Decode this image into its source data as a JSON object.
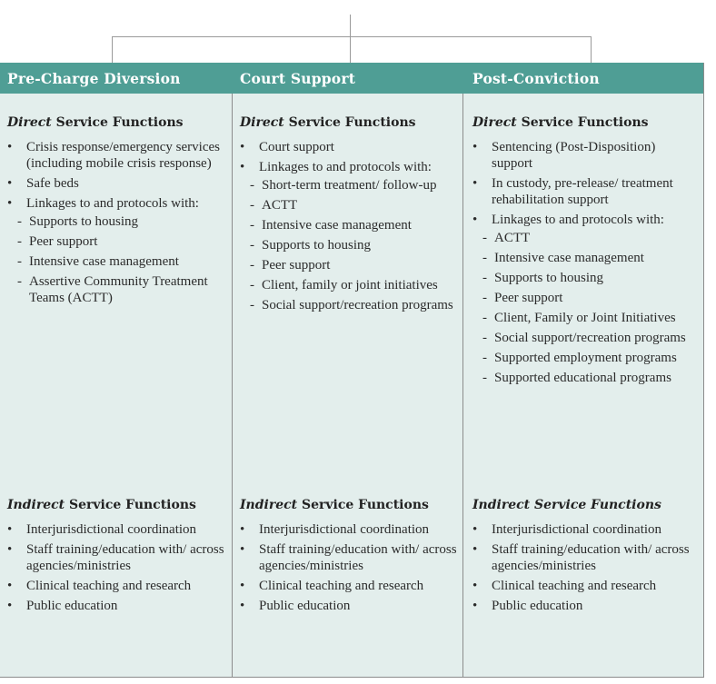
{
  "columns": [
    {
      "title": "Pre-Charge Diversion",
      "direct": {
        "title_em": "Direct",
        "title_rest": " Service Functions",
        "items": [
          {
            "text": "Crisis response/emergency services (including mobile crisis response)"
          },
          {
            "text": "Safe beds"
          },
          {
            "text": "Linkages to and protocols with:",
            "sub": [
              "Supports to housing",
              "Peer support",
              "Intensive case management",
              "Assertive Community Treatment Teams (ACTT)"
            ]
          }
        ]
      },
      "indirect": {
        "title_em": "Indirect",
        "title_rest": " Service Functions",
        "items": [
          "Interjurisdictional coordination",
          "Staff training/education with/ across agencies/ministries",
          "Clinical teaching and research",
          "Public education"
        ]
      }
    },
    {
      "title": "Court Support",
      "direct": {
        "title_em": "Direct",
        "title_rest": " Service Functions",
        "items": [
          {
            "text": "Court support"
          },
          {
            "text": "Linkages to and protocols with:",
            "sub": [
              "Short-term treatment/ follow-up",
              "ACTT",
              "Intensive case management",
              "Supports to housing",
              "Peer support",
              "Client, family or joint initiatives",
              "Social support/recreation programs"
            ]
          }
        ]
      },
      "indirect": {
        "title_em": "Indirect",
        "title_rest": " Service Functions",
        "items": [
          "Interjurisdictional coordination",
          "Staff training/education with/ across agencies/ministries",
          "Clinical teaching and research",
          "Public education"
        ]
      }
    },
    {
      "title": "Post-Conviction",
      "direct": {
        "title_em": "Direct",
        "title_rest": " Service Functions",
        "items": [
          {
            "text": "Sentencing (Post-Disposition) support"
          },
          {
            "text": "In custody, pre-release/ treatment rehabilitation support"
          },
          {
            "text": "Linkages to and protocols with:",
            "sub": [
              "ACTT",
              "Intensive case management",
              "Supports to housing",
              "Peer support",
              "Client, Family or Joint Initiatives",
              "Social support/recreation programs",
              "Supported employment programs",
              "Supported educational programs"
            ]
          }
        ]
      },
      "indirect": {
        "title_em": "Indirect Service Functions",
        "title_rest": "",
        "items": [
          "Interjurisdictional coordination",
          "Staff training/education with/ across agencies/ministries",
          "Clinical teaching and research",
          "Public education"
        ]
      }
    }
  ],
  "symbols": {
    "bullet": "•",
    "dash": "-"
  },
  "colors": {
    "header": "#4f9e95",
    "panel": "#e3eeec",
    "border": "#8c8c8c"
  }
}
